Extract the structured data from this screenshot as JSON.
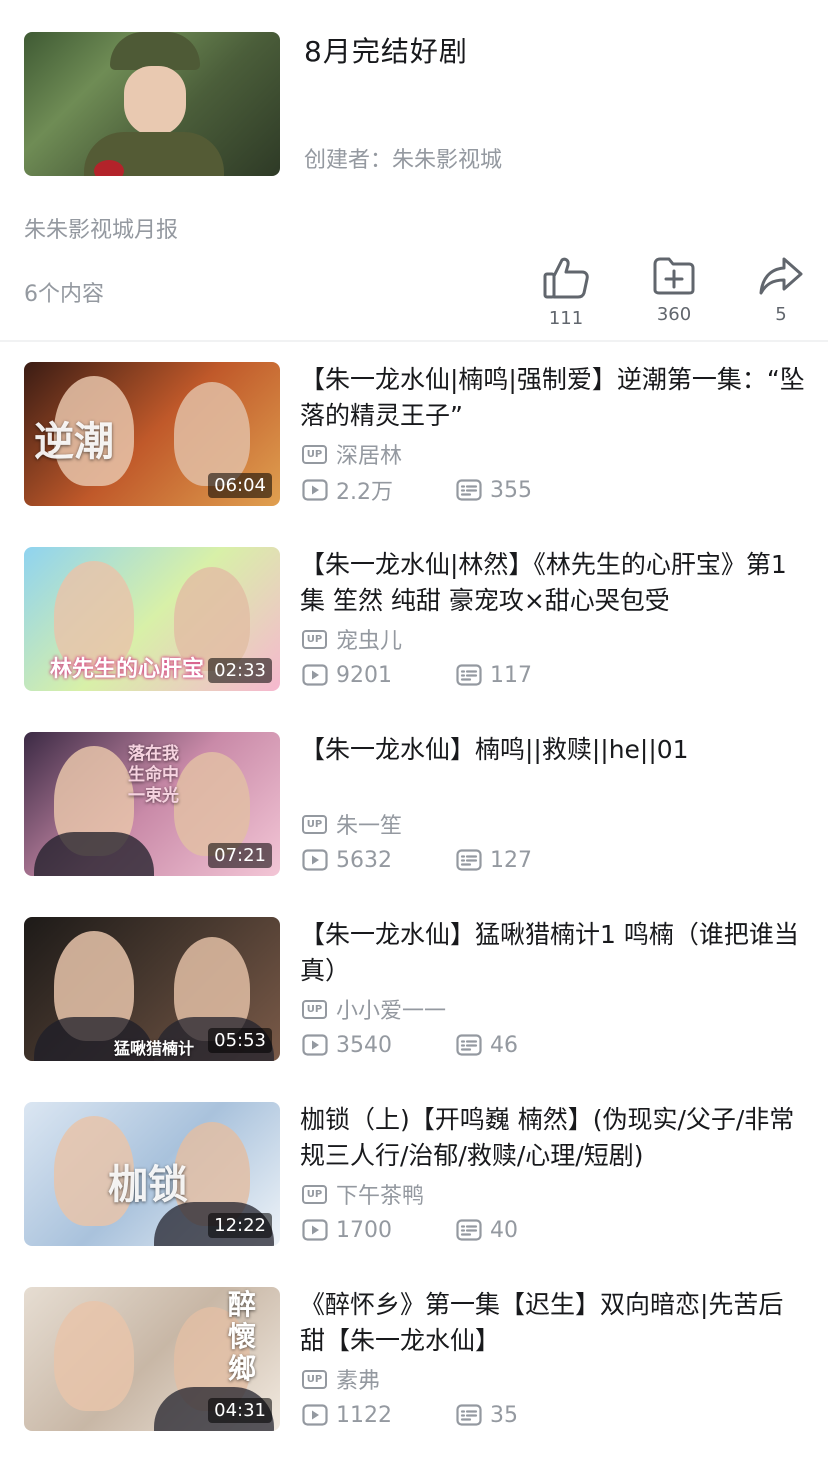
{
  "playlist": {
    "title": "8月完结好剧",
    "creator": "创建者：朱朱影视城",
    "description": "朱朱影视城月报",
    "content_count": "6个内容"
  },
  "actions": {
    "like": {
      "icon": "thumb-up-icon",
      "count": "111"
    },
    "favorite": {
      "icon": "add-folder-icon",
      "count": "360"
    },
    "share": {
      "icon": "share-arrow-icon",
      "count": "5"
    }
  },
  "videos": [
    {
      "title": "【朱一龙水仙|楠鸣|强制爱】逆潮第一集：“坠落的精灵王子”",
      "uploader": "深居林",
      "plays": "2.2万",
      "danmaku": "355",
      "duration": "06:04",
      "thumb_text": "逆潮",
      "thumb_colors": [
        "#3a1c14",
        "#c0592a",
        "#e0a050"
      ]
    },
    {
      "title": "【朱一龙水仙|林然】《林先生的心肝宝》第1集 笙然 纯甜 豪宠攻×甜心哭包受",
      "uploader": "宠虫儿",
      "plays": "9201",
      "danmaku": "117",
      "duration": "02:33",
      "thumb_text": "林先生的心肝宝",
      "thumb_colors": [
        "#8fd3f0",
        "#d8f0a8",
        "#f6b7cf"
      ]
    },
    {
      "title": "【朱一龙水仙】楠鸣||救赎||he||01",
      "uploader": "朱一笙",
      "plays": "5632",
      "danmaku": "127",
      "duration": "07:21",
      "thumb_text": "落在我生命中一束光",
      "thumb_colors": [
        "#3b2a44",
        "#c98aa8",
        "#f3c6d6"
      ]
    },
    {
      "title": "【朱一龙水仙】猛啾猎楠计1 鸣楠（谁把谁当真）",
      "uploader": "小小爱一一",
      "plays": "3540",
      "danmaku": "46",
      "duration": "05:53",
      "thumb_text": "猛啾猎楠计",
      "thumb_colors": [
        "#1d1a18",
        "#4a3a30",
        "#7a5a48"
      ]
    },
    {
      "title": "枷锁（上)【开鸣巍 楠然】(伪现实/父子/非常规三人行/治郁/救赎/心理/短剧)",
      "uploader": "下午茶鸭",
      "plays": "1700",
      "danmaku": "40",
      "duration": "12:22",
      "thumb_text": "枷锁",
      "thumb_colors": [
        "#dbe6f2",
        "#a9c2dc",
        "#eef3f8"
      ]
    },
    {
      "title": "《醉怀乡》第一集【迟生】双向暗恋|先苦后甜【朱一龙水仙】",
      "uploader": "素弗",
      "plays": "1122",
      "danmaku": "35",
      "duration": "04:31",
      "thumb_text": "醉懷鄉",
      "thumb_colors": [
        "#e6ddd2",
        "#c8b7a6",
        "#f1e9df"
      ]
    }
  ],
  "colors": {
    "text_primary": "#18191c",
    "text_secondary": "#9499a0",
    "icon": "#61666d",
    "divider": "#f1f2f3"
  }
}
